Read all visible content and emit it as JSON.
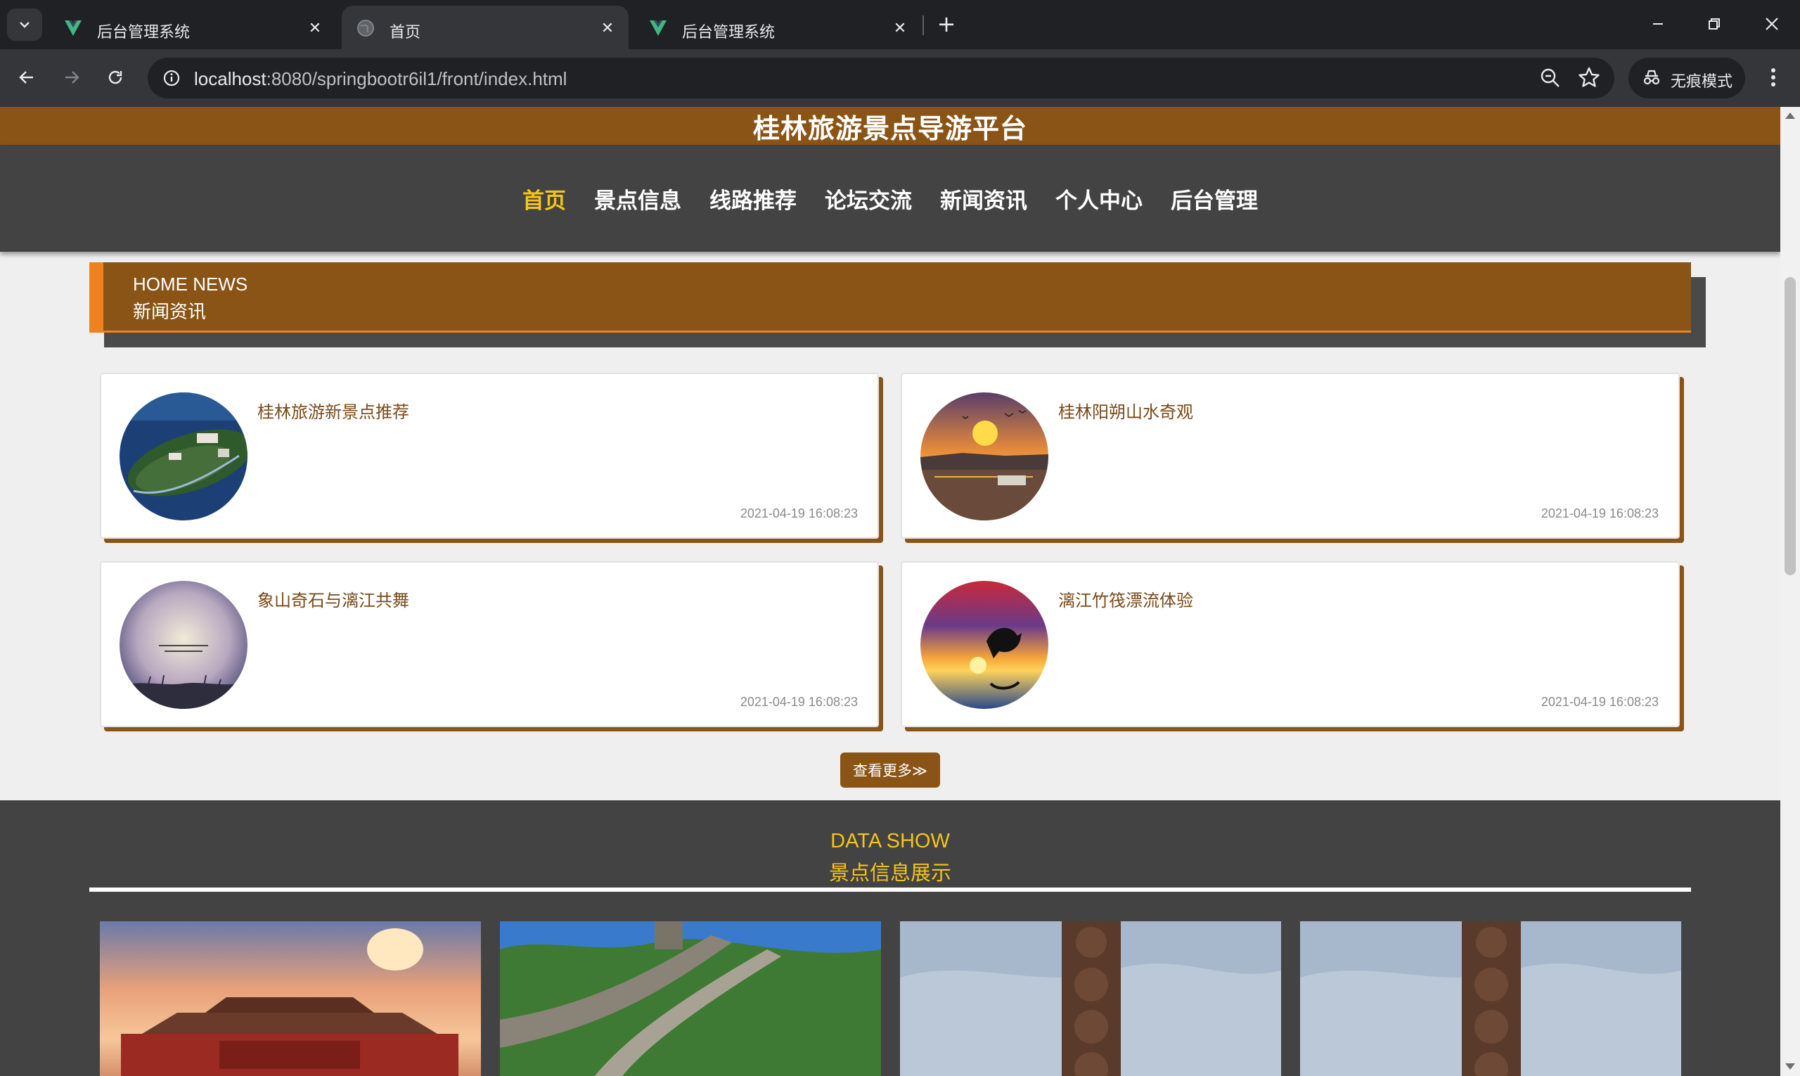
{
  "browser": {
    "tabs": [
      {
        "title": "后台管理系统",
        "active": false,
        "icon": "vue-icon"
      },
      {
        "title": "首页",
        "active": true,
        "icon": "globe-icon"
      },
      {
        "title": "后台管理系统",
        "active": false,
        "icon": "vue-icon"
      }
    ],
    "url_host": "localhost",
    "url_path": ":8080/springbootr6il1/front/index.html",
    "incognito_label": "无痕模式"
  },
  "site": {
    "title": "桂林旅游景点导游平台",
    "nav": [
      "首页",
      "景点信息",
      "线路推荐",
      "论坛交流",
      "新闻资讯",
      "个人中心",
      "后台管理"
    ],
    "active_nav": "首页"
  },
  "news": {
    "heading_en": "HOME NEWS",
    "heading_cn": "新闻资讯",
    "items": [
      {
        "title": "桂林旅游新景点推荐",
        "date": "2021-04-19 16:08:23"
      },
      {
        "title": "桂林阳朔山水奇观",
        "date": "2021-04-19 16:08:23"
      },
      {
        "title": "象山奇石与漓江共舞",
        "date": "2021-04-19 16:08:23"
      },
      {
        "title": "漓江竹筏漂流体验",
        "date": "2021-04-19 16:08:23"
      }
    ],
    "more_label": "查看更多≫"
  },
  "data_show": {
    "heading_en": "DATA SHOW",
    "heading_cn": "景点信息展示"
  },
  "colors": {
    "brand_brown": "#8a5416",
    "accent_orange": "#f0821e",
    "accent_yellow": "#f5c518",
    "nav_bg": "#434343"
  }
}
